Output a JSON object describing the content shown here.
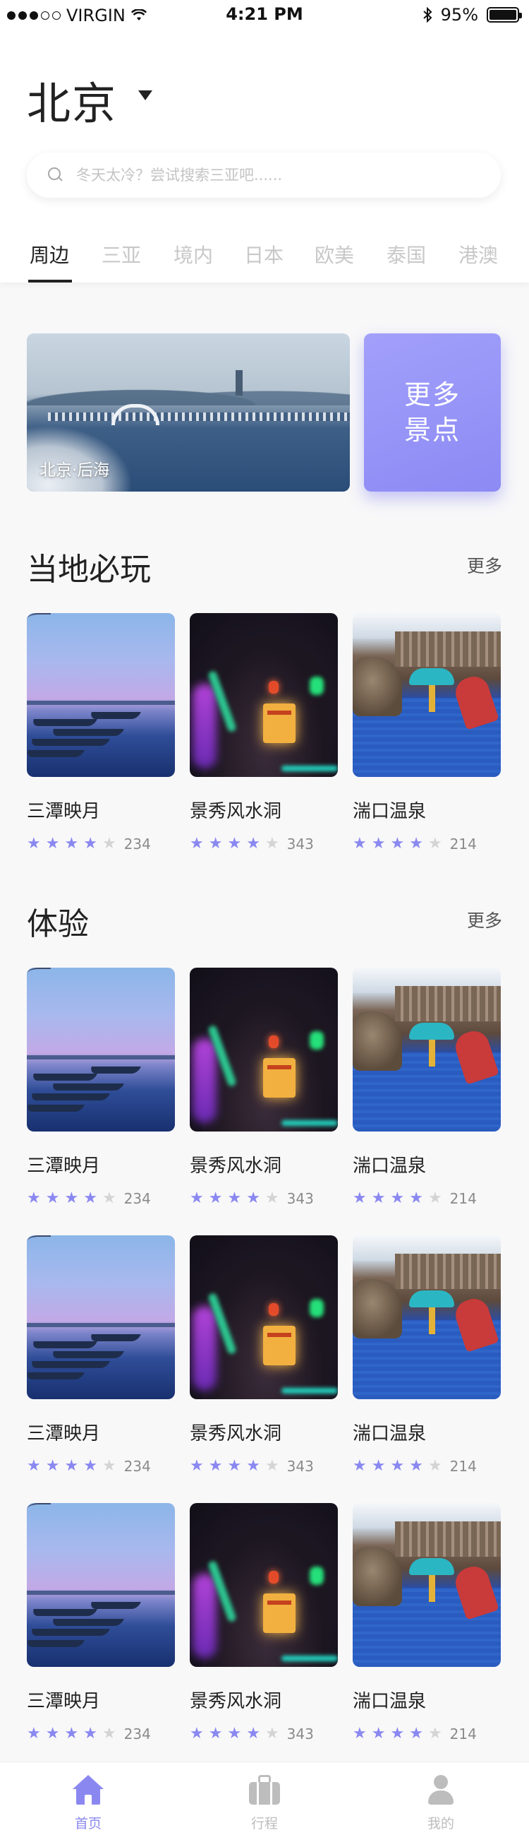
{
  "status_bar": {
    "carrier": "VIRGIN",
    "time": "4:21 PM",
    "battery": "95%",
    "icons": [
      "signal-dots-icon",
      "wifi-icon",
      "bluetooth-icon",
      "battery-icon"
    ]
  },
  "header": {
    "city": "北京",
    "city_dropdown_icon": "caret-down-icon"
  },
  "search": {
    "placeholder": "冬天太冷？尝试搜索三亚吧......",
    "icon": "search-icon"
  },
  "tabs": [
    {
      "label": "周边",
      "active": true
    },
    {
      "label": "三亚",
      "active": false
    },
    {
      "label": "境内",
      "active": false
    },
    {
      "label": "日本",
      "active": false
    },
    {
      "label": "欧美",
      "active": false
    },
    {
      "label": "泰国",
      "active": false
    },
    {
      "label": "港澳",
      "active": false
    }
  ],
  "banner": {
    "caption": "北京·后海",
    "more_button": "更多景点"
  },
  "sections": [
    {
      "title": "当地必玩",
      "more": "更多",
      "rows": [
        [
          {
            "name": "三潭映月",
            "stars": 4,
            "count": "234",
            "image": "lake-boats"
          },
          {
            "name": "景秀风水洞",
            "stars": 4,
            "count": "343",
            "image": "cave-lights"
          },
          {
            "name": "湍口温泉",
            "stars": 4,
            "count": "214",
            "image": "hot-spring-pool"
          }
        ]
      ]
    },
    {
      "title": "体验",
      "more": "更多",
      "rows": [
        [
          {
            "name": "三潭映月",
            "stars": 4,
            "count": "234",
            "image": "lake-boats"
          },
          {
            "name": "景秀风水洞",
            "stars": 4,
            "count": "343",
            "image": "cave-lights"
          },
          {
            "name": "湍口温泉",
            "stars": 4,
            "count": "214",
            "image": "hot-spring-pool"
          }
        ],
        [
          {
            "name": "三潭映月",
            "stars": 4,
            "count": "234",
            "image": "lake-boats"
          },
          {
            "name": "景秀风水洞",
            "stars": 4,
            "count": "343",
            "image": "cave-lights"
          },
          {
            "name": "湍口温泉",
            "stars": 4,
            "count": "214",
            "image": "hot-spring-pool"
          }
        ],
        [
          {
            "name": "三潭映月",
            "stars": 4,
            "count": "234",
            "image": "lake-boats"
          },
          {
            "name": "景秀风水洞",
            "stars": 4,
            "count": "343",
            "image": "cave-lights"
          },
          {
            "name": "湍口温泉",
            "stars": 4,
            "count": "214",
            "image": "hot-spring-pool"
          }
        ]
      ]
    }
  ],
  "bottom_nav": [
    {
      "label": "首页",
      "icon": "home-icon",
      "active": true
    },
    {
      "label": "行程",
      "icon": "luggage-icon",
      "active": false
    },
    {
      "label": "我的",
      "icon": "user-icon",
      "active": false
    }
  ],
  "colors": {
    "accent": "#8a88f0",
    "text_primary": "#222222",
    "text_muted": "#c8c8c8",
    "star_off": "#d4d4d4",
    "background": "#f8f8f9"
  }
}
